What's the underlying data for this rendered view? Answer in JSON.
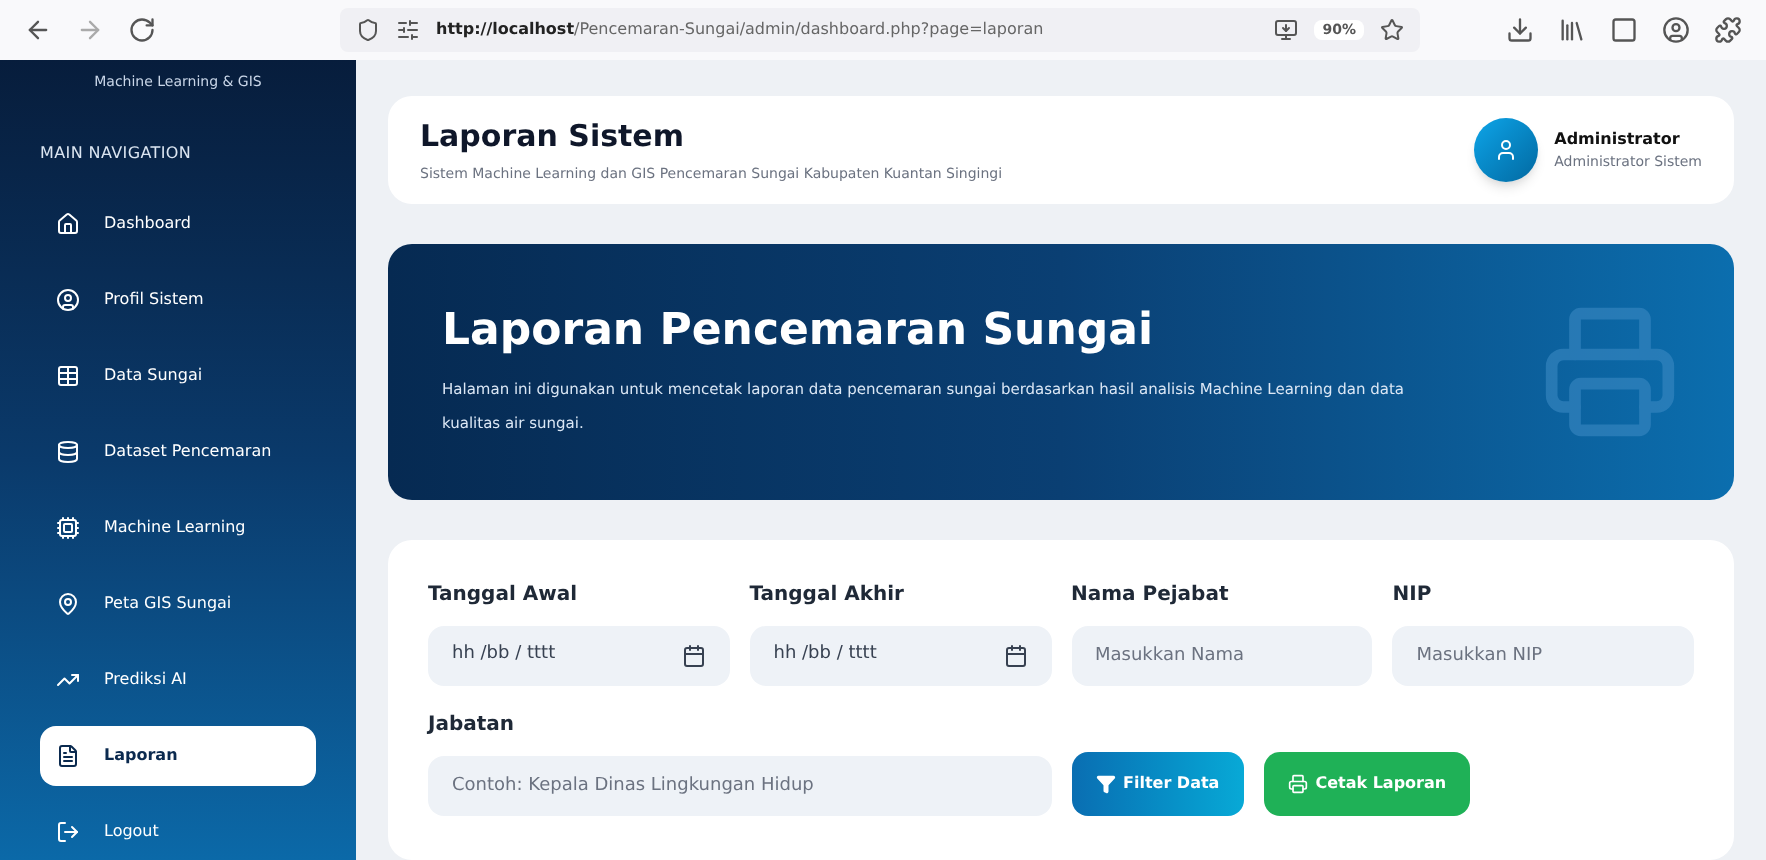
{
  "browser": {
    "url_host": "http://localhost",
    "url_path": "/Pencemaran-Sungai/admin/dashboard.php?page=laporan",
    "zoom": "90%"
  },
  "sidebar": {
    "subtitle": "Machine Learning & GIS",
    "section": "MAIN NAVIGATION",
    "items": [
      {
        "label": "Dashboard",
        "selected": false
      },
      {
        "label": "Profil Sistem",
        "selected": false
      },
      {
        "label": "Data Sungai",
        "selected": false
      },
      {
        "label": "Dataset Pencemaran",
        "selected": false
      },
      {
        "label": "Machine Learning",
        "selected": false
      },
      {
        "label": "Peta GIS Sungai",
        "selected": false
      },
      {
        "label": "Prediksi AI",
        "selected": false
      },
      {
        "label": "Laporan",
        "selected": true
      },
      {
        "label": "Logout",
        "selected": false
      }
    ]
  },
  "header": {
    "title": "Laporan Sistem",
    "subtitle": "Sistem Machine Learning dan GIS Pencemaran Sungai Kabupaten Kuantan Singingi",
    "user": {
      "name": "Administrator",
      "role": "Administrator Sistem"
    }
  },
  "hero": {
    "title": "Laporan Pencemaran Sungai",
    "text": "Halaman ini digunakan untuk mencetak laporan data pencemaran sungai berdasarkan hasil analisis Machine Learning dan data kualitas air sungai."
  },
  "form": {
    "fields": [
      {
        "label": "Tanggal Awal",
        "kind": "date",
        "placeholder": "hh /bb / tttt"
      },
      {
        "label": "Tanggal Akhir",
        "kind": "date",
        "placeholder": "hh /bb / tttt"
      },
      {
        "label": "Nama Pejabat",
        "kind": "text",
        "placeholder": "Masukkan Nama"
      },
      {
        "label": "NIP",
        "kind": "text",
        "placeholder": "Masukkan NIP"
      },
      {
        "label": "Jabatan",
        "kind": "text",
        "placeholder": "Contoh: Kepala Dinas Lingkungan Hidup"
      }
    ],
    "buttons": [
      {
        "label": "Filter Data",
        "kind": "filter"
      },
      {
        "label": "Cetak Laporan",
        "kind": "print"
      }
    ]
  }
}
